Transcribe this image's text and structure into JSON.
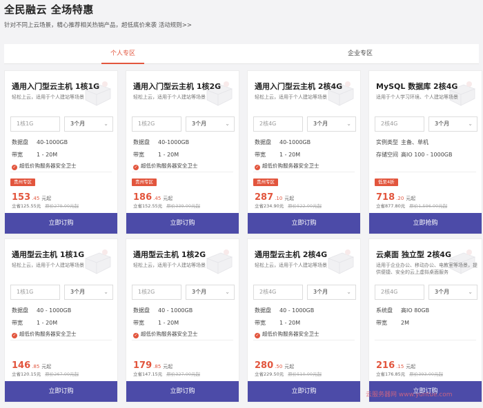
{
  "header": {
    "title": "全民融云 全场特惠",
    "subtitle": "针对不同上云场景，精心推荐相关热销产品，超低底价来袭",
    "rules_link": "活动规则>>"
  },
  "tabs": [
    {
      "label": "个人专区",
      "active": true
    },
    {
      "label": "企业专区",
      "active": false
    }
  ],
  "colors": {
    "accent": "#e2553d",
    "button": "#4c4ba8"
  },
  "cards": [
    {
      "title": "通用入门型云主机 1核1G",
      "desc": "轻松上云，适用于个人建站等场景",
      "spec_select": "1核1G",
      "duration_select": "3个月",
      "specs": [
        {
          "k": "数据盘",
          "v": "40-1000GB"
        },
        {
          "k": "带宽",
          "v": "1 - 20M"
        }
      ],
      "security": "超低价购服务器安全卫士",
      "badge": "贵州专区",
      "price_int": "153",
      "price_dec": ".45",
      "price_unit": "元起",
      "save": "立省125.55元",
      "orig": "原价279.00元起",
      "button": "立即订购"
    },
    {
      "title": "通用入门型云主机 1核2G",
      "desc": "轻松上云，适用于个人建站等场景",
      "spec_select": "1核2G",
      "duration_select": "3个月",
      "specs": [
        {
          "k": "数据盘",
          "v": "40-1000GB"
        },
        {
          "k": "带宽",
          "v": "1 - 20M"
        }
      ],
      "security": "超低价购服务器安全卫士",
      "badge": "贵州专区",
      "price_int": "186",
      "price_dec": ".45",
      "price_unit": "元起",
      "save": "立省152.55元",
      "orig": "原价339.00元起",
      "button": "立即订购"
    },
    {
      "title": "通用入门型云主机 2核4G",
      "desc": "轻松上云，适用于个人建站等场景",
      "spec_select": "2核4G",
      "duration_select": "3个月",
      "specs": [
        {
          "k": "数据盘",
          "v": "40-1000GB"
        },
        {
          "k": "带宽",
          "v": "1 - 20M"
        }
      ],
      "security": "超低价购服务器安全卫士",
      "badge": "贵州专区",
      "price_int": "287",
      "price_dec": ".10",
      "price_unit": "元起",
      "save": "立省234.90元",
      "orig": "原价522.00元起",
      "button": "立即订购"
    },
    {
      "title": "MySQL 数据库 2核4G",
      "desc": "适用于个人学习环境、个人建站等场景",
      "spec_select": "2核4G",
      "duration_select": "3个月",
      "specs": [
        {
          "k": "实例类型",
          "v": "主备、单机"
        },
        {
          "k": "存储空间",
          "v": "高IO 100 - 1000GB"
        }
      ],
      "security": "",
      "badge": "低至4折",
      "price_int": "718",
      "price_dec": ".20",
      "price_unit": "元起",
      "save": "立省877.80元",
      "orig": "原价1,596.00元起",
      "button": "立即抢购"
    },
    {
      "title": "通用型云主机 1核1G",
      "desc": "轻松上云，适用于个人建站等场景",
      "spec_select": "1核1G",
      "duration_select": "3个月",
      "specs": [
        {
          "k": "数据盘",
          "v": "40 - 1000GB"
        },
        {
          "k": "带宽",
          "v": "1 - 20M"
        }
      ],
      "security": "超低价购服务器安全卫士",
      "badge": "",
      "price_int": "146",
      "price_dec": ".85",
      "price_unit": "元起",
      "save": "立省120.15元",
      "orig": "原价267.00元起",
      "button": "立即订购"
    },
    {
      "title": "通用型云主机 1核2G",
      "desc": "轻松上云，适用于个人建站等场景",
      "spec_select": "1核2G",
      "duration_select": "3个月",
      "specs": [
        {
          "k": "数据盘",
          "v": "40 - 1000GB"
        },
        {
          "k": "带宽",
          "v": "1 - 20M"
        }
      ],
      "security": "超低价购服务器安全卫士",
      "badge": "",
      "price_int": "179",
      "price_dec": ".85",
      "price_unit": "元起",
      "save": "立省147.15元",
      "orig": "原价327.00元起",
      "button": "立即订购"
    },
    {
      "title": "通用型云主机 2核4G",
      "desc": "轻松上云，适用于个人建站等场景",
      "spec_select": "2核4G",
      "duration_select": "3个月",
      "specs": [
        {
          "k": "数据盘",
          "v": "40 - 1000GB"
        },
        {
          "k": "带宽",
          "v": "1 - 20M"
        }
      ],
      "security": "超低价购服务器安全卫士",
      "badge": "",
      "price_int": "280",
      "price_dec": ".50",
      "price_unit": "元起",
      "save": "立省229.50元",
      "orig": "原价510.00元起",
      "button": "立即订购"
    },
    {
      "title": "云桌面 独立型 2核4G",
      "desc": "适用于企业办公、移动办公、电教室等场景，提供便捷、安全的云上虚拟桌面服务",
      "spec_select": "2核4G",
      "duration_select": "3个月",
      "specs": [
        {
          "k": "系统盘",
          "v": "高IO 80GB"
        },
        {
          "k": "带宽",
          "v": "2M"
        }
      ],
      "security": "",
      "badge": "",
      "price_int": "216",
      "price_dec": ".15",
      "price_unit": "元起",
      "save": "立省176.85元",
      "orig": "原价393.00元起",
      "button": "立即订购"
    }
  ],
  "watermark": "云服务器网 www.yuntue.com"
}
